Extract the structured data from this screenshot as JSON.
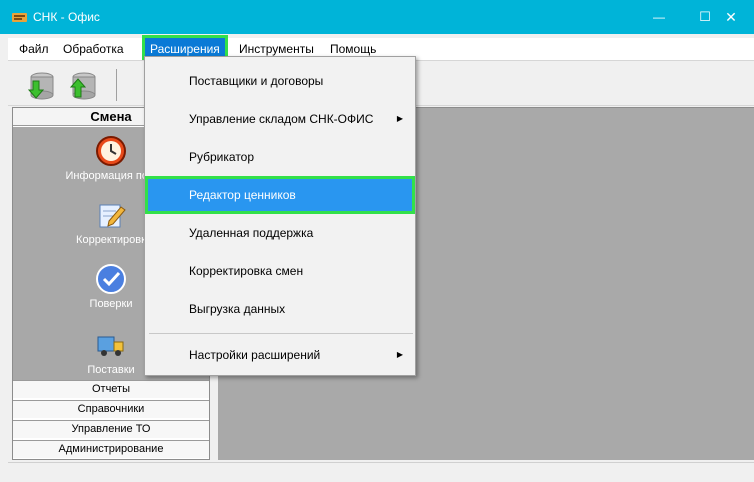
{
  "window": {
    "title": "СНК - Офис",
    "minimize_glyph": "—",
    "maximize_glyph": "☐",
    "close_glyph": "✕"
  },
  "menubar": [
    {
      "label": "Файл"
    },
    {
      "label": "Обработка"
    },
    {
      "label": "Расширения"
    },
    {
      "label": "Инструменты"
    },
    {
      "label": "Помощь"
    }
  ],
  "toolbar": {
    "buttons": [
      {
        "icon": "database-download-icon"
      },
      {
        "icon": "database-upload-icon"
      }
    ]
  },
  "left_panel": {
    "header": "Смена",
    "items": [
      {
        "label": "Информация по с",
        "icon": "clock-icon"
      },
      {
        "label": "Корректировк",
        "icon": "edit-pencil-icon"
      },
      {
        "label": "Поверки",
        "icon": "checkmark-icon"
      },
      {
        "label": "Поставки",
        "icon": "delivery-truck-icon"
      }
    ],
    "sections": [
      {
        "label": "Отчеты"
      },
      {
        "label": "Справочники"
      },
      {
        "label": "Управление ТО"
      },
      {
        "label": "Администрирование"
      }
    ]
  },
  "dropdown": {
    "items": [
      {
        "label": "Поставщики и договоры"
      },
      {
        "label": "Управление складом СНК-ОФИС",
        "submenu": "▶"
      },
      {
        "label": "Рубрикатор"
      },
      {
        "label": "Редактор ценников"
      },
      {
        "label": "Удаленная поддержка"
      },
      {
        "label": "Корректировка смен"
      },
      {
        "label": "Выгрузка данных"
      },
      {
        "label": "Настройки расширений",
        "submenu": "▶"
      }
    ]
  },
  "colors": {
    "titlebar": "#00b4d8",
    "highlight": "#2996f0",
    "focus_outline": "#33e04a",
    "panel_body": "#a8a8a8",
    "workspace": "#a9a9a9"
  }
}
